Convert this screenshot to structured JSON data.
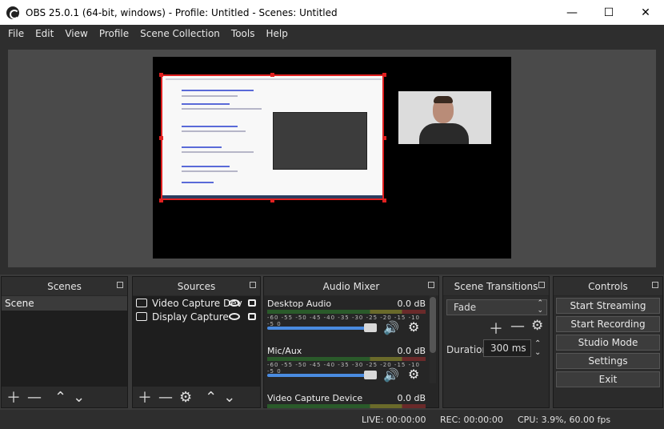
{
  "window": {
    "title": "OBS 25.0.1 (64-bit, windows) - Profile: Untitled - Scenes: Untitled",
    "minimize_icon": "minimize-icon",
    "maximize_icon": "maximize-icon",
    "close_icon": "close-icon"
  },
  "menu": [
    "File",
    "Edit",
    "View",
    "Profile",
    "Scene Collection",
    "Tools",
    "Help"
  ],
  "docks": {
    "scenes": {
      "title": "Scenes",
      "items": [
        "Scene"
      ]
    },
    "sources": {
      "title": "Sources",
      "items": [
        "Video Capture Dev",
        "Display Capture"
      ]
    },
    "mixer": {
      "title": "Audio Mixer",
      "scale": "-60 -55 -50 -45 -40 -35 -30 -25 -20 -15 -10 -5 0",
      "channels": [
        {
          "name": "Desktop Audio",
          "db": "0.0 dB"
        },
        {
          "name": "Mic/Aux",
          "db": "0.0 dB"
        },
        {
          "name": "Video Capture Device",
          "db": "0.0 dB"
        }
      ]
    },
    "transitions": {
      "title": "Scene Transitions",
      "selected": "Fade",
      "duration_label": "Duration",
      "duration_value": "300 ms"
    },
    "controls": {
      "title": "Controls",
      "buttons": [
        "Start Streaming",
        "Start Recording",
        "Studio Mode",
        "Settings",
        "Exit"
      ]
    }
  },
  "status": {
    "live": "LIVE: 00:00:00",
    "rec": "REC: 00:00:00",
    "cpu": "CPU: 3.9%, 60.00 fps"
  }
}
